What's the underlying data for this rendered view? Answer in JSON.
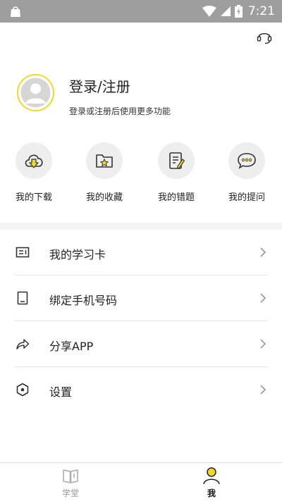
{
  "status_bar": {
    "time": "7:21"
  },
  "profile": {
    "title": "登录/注册",
    "subtitle": "登录或注册后使用更多功能"
  },
  "quick_actions": [
    {
      "label": "我的下载",
      "icon": "cloud-download-icon"
    },
    {
      "label": "我的收藏",
      "icon": "star-folder-icon"
    },
    {
      "label": "我的错题",
      "icon": "notebook-edit-icon"
    },
    {
      "label": "我的提问",
      "icon": "chat-bubble-icon"
    }
  ],
  "menu": [
    {
      "label": "我的学习卡",
      "icon": "study-card-icon"
    },
    {
      "label": "绑定手机号码",
      "icon": "phone-icon"
    },
    {
      "label": "分享APP",
      "icon": "share-icon"
    },
    {
      "label": "设置",
      "icon": "settings-icon"
    }
  ],
  "tabs": [
    {
      "label": "学堂",
      "icon": "book-icon",
      "active": false
    },
    {
      "label": "我",
      "icon": "person-icon",
      "active": true
    }
  ],
  "colors": {
    "accent": "#f2d82a",
    "statusbar": "#9e9e9e",
    "text": "#222222"
  }
}
